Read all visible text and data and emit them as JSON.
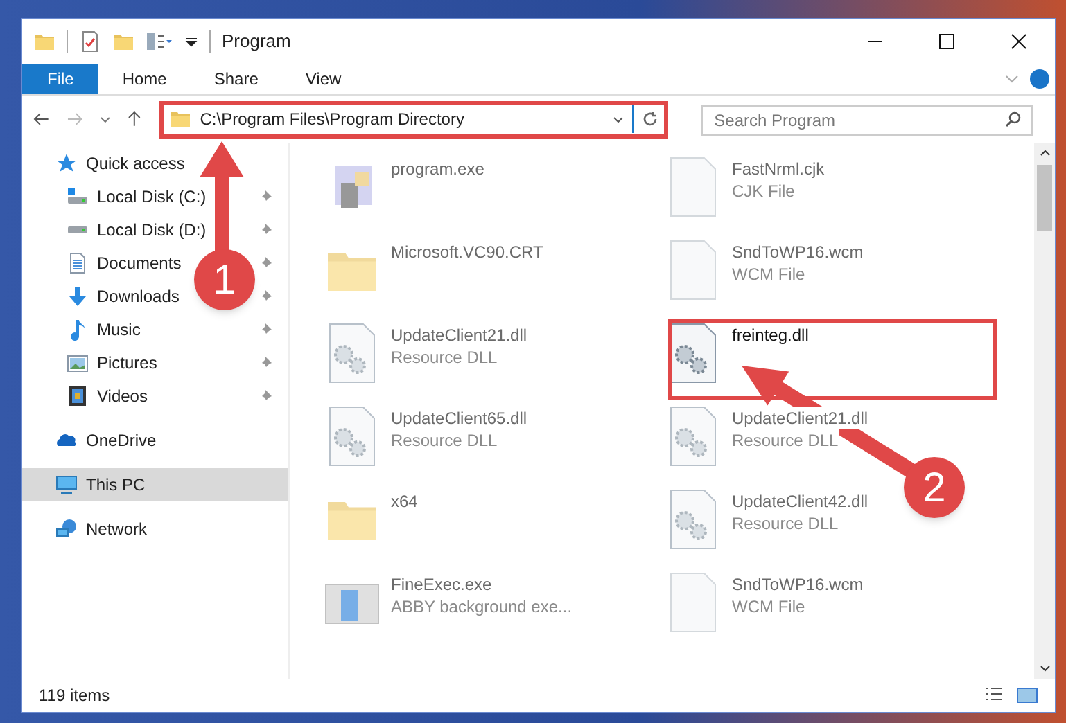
{
  "window": {
    "title": "Program"
  },
  "ribbon_tabs": [
    {
      "label": "File",
      "selected": true
    },
    {
      "label": "Home",
      "selected": false
    },
    {
      "label": "Share",
      "selected": false
    },
    {
      "label": "View",
      "selected": false
    }
  ],
  "address": {
    "path": "C:\\Program Files\\Program Directory"
  },
  "search": {
    "placeholder": "Search Program"
  },
  "nav": [
    {
      "label": "Quick access",
      "kind": "quick",
      "pinned": false,
      "selected": false,
      "children": [
        {
          "label": "Local Disk (C:)",
          "kind": "disk-c",
          "pinned": true,
          "selected": false
        },
        {
          "label": "Local Disk (D:)",
          "kind": "disk",
          "pinned": true,
          "selected": false
        },
        {
          "label": "Documents",
          "kind": "documents",
          "pinned": true,
          "selected": false
        },
        {
          "label": "Downloads",
          "kind": "downloads",
          "pinned": true,
          "selected": false
        },
        {
          "label": "Music",
          "kind": "music",
          "pinned": true,
          "selected": false
        },
        {
          "label": "Pictures",
          "kind": "pictures",
          "pinned": true,
          "selected": false
        },
        {
          "label": "Videos",
          "kind": "videos",
          "pinned": true,
          "selected": false
        }
      ]
    },
    {
      "label": "OneDrive",
      "kind": "onedrive",
      "pinned": false,
      "selected": false
    },
    {
      "label": "This PC",
      "kind": "pc",
      "pinned": false,
      "selected": true
    },
    {
      "label": "Network",
      "kind": "network",
      "pinned": false,
      "selected": false
    }
  ],
  "files": [
    {
      "name": "program.exe",
      "kind": "exe",
      "blurred": true
    },
    {
      "name": "FastNrml.cjk",
      "type": "CJK File",
      "kind": "file",
      "blurred": true
    },
    {
      "name": "Microsoft.VC90.CRT",
      "kind": "folder",
      "blurred": true
    },
    {
      "name": "SndToWP16.wcm",
      "type": "WCM File",
      "kind": "file",
      "blurred": true
    },
    {
      "name": "UpdateClient21.dll",
      "type": "Resource DLL",
      "kind": "dll",
      "blurred": true
    },
    {
      "name": "freinteg.dll",
      "kind": "dll",
      "blurred": false
    },
    {
      "name": "UpdateClient65.dll",
      "type": "Resource DLL",
      "kind": "dll",
      "blurred": true
    },
    {
      "name": "UpdateClient21.dll",
      "type": "Resource DLL",
      "kind": "dll",
      "blurred": true
    },
    {
      "name": "x64",
      "kind": "folder",
      "blurred": true
    },
    {
      "name": "UpdateClient42.dll",
      "type": "Resource DLL",
      "kind": "dll",
      "blurred": true
    },
    {
      "name": "FineExec.exe",
      "type": "ABBY background exe...",
      "kind": "app",
      "blurred": true
    },
    {
      "name": "SndToWP16.wcm",
      "type": "WCM File",
      "kind": "file",
      "blurred": true
    }
  ],
  "status_bar": {
    "count": "119 items"
  },
  "callouts": [
    {
      "number": "1"
    },
    {
      "number": "2"
    }
  ]
}
